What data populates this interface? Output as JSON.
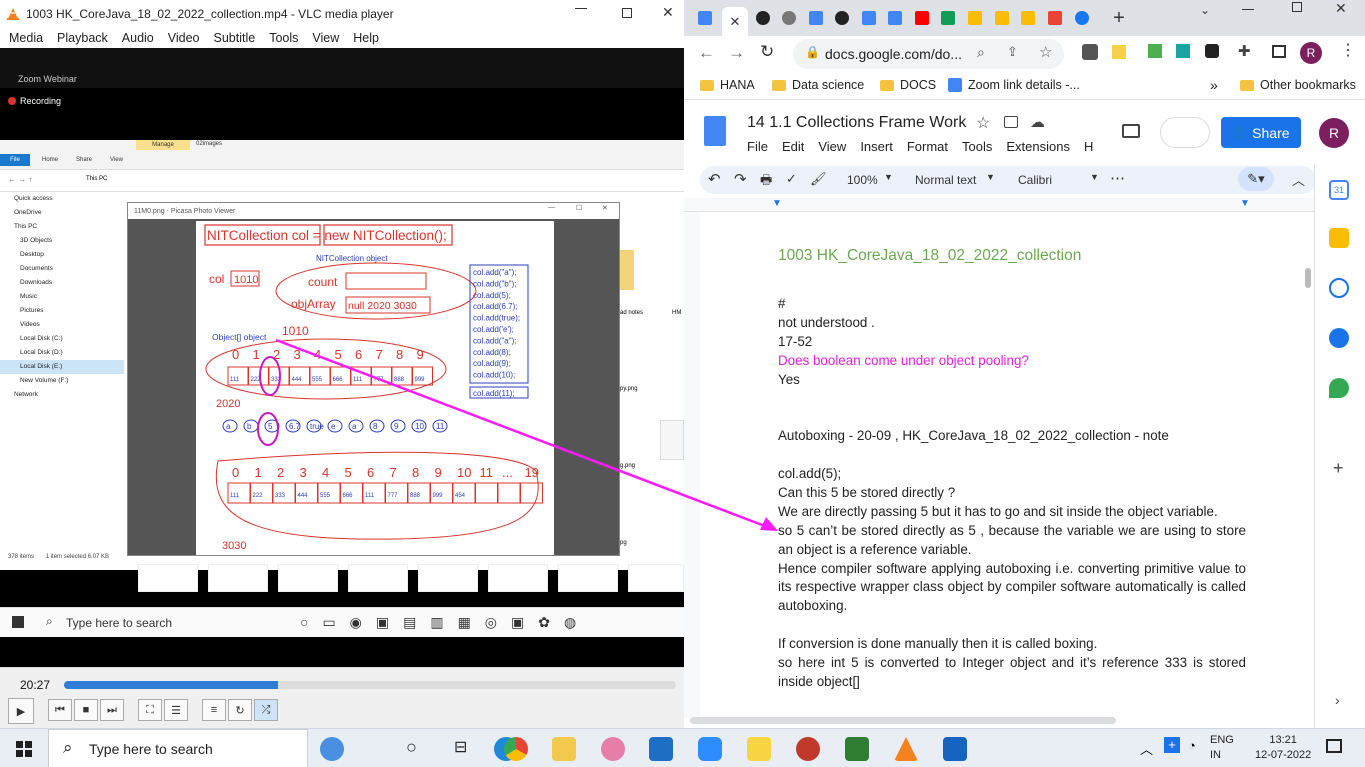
{
  "vlc": {
    "title": "1003 HK_CoreJava_18_02_2022_collection.mp4 - VLC media player",
    "menu": [
      "Media",
      "Playback",
      "Audio",
      "Video",
      "Subtitle",
      "Tools",
      "View",
      "Help"
    ],
    "time": "20:27",
    "progress": 0.35
  },
  "video": {
    "zoom_title": "Zoom Webinar",
    "recording": "Recording",
    "explorer": {
      "ribbon_tab_manage": "Manage",
      "ribbon_tab_images": "02images",
      "ribbon_tabs": [
        "File",
        "Home",
        "Share",
        "View"
      ],
      "address": "This PC",
      "nav": [
        "Quick access",
        "OneDrive",
        "This PC",
        "3D Objects",
        "Desktop",
        "Documents",
        "Downloads",
        "Music",
        "Pictures",
        "Videos",
        "Local Disk (C:)",
        "Local Disk (D:)",
        "Local Disk (E:)",
        "New Volume (F:)",
        "Network"
      ],
      "status_items": "378 items",
      "status_selected": "1 item selected  6.07 KB",
      "thumb_labels": [
        "ad notes",
        "HM",
        "py.png",
        "g.png",
        "pg"
      ]
    },
    "picasa_title": "11M0.png - Picasa Photo Viewer",
    "slide": {
      "top_line": "NITCollection col = new NITCollection();",
      "object_label": "NITCollection object",
      "col_value": "1010",
      "count": "count",
      "objArray": "objArray",
      "objArray_value": "null 2020 3030",
      "addr_1010": "1010",
      "object_array_label": "Object[] object",
      "addr_2020": "2020",
      "addr_3030": "3030",
      "col_label": "col",
      "indices_top": [
        "0",
        "1",
        "2",
        "3",
        "4",
        "5",
        "6",
        "7",
        "8",
        "9"
      ],
      "refs_top": [
        "111",
        "222",
        "333",
        "444",
        "555",
        "666",
        "111",
        "777",
        "888",
        "999"
      ],
      "values": [
        "a",
        "b",
        "5",
        "6.7",
        "true",
        "e",
        "a",
        "8",
        "9",
        "10",
        "11"
      ],
      "indices_bottom": [
        "0",
        "1",
        "2",
        "3",
        "4",
        "5",
        "6",
        "7",
        "8",
        "9",
        "10",
        "11",
        "...",
        "19"
      ],
      "refs_bottom": [
        "111",
        "222",
        "333",
        "444",
        "555",
        "666",
        "111",
        "777",
        "888",
        "999",
        "454"
      ],
      "calls": [
        "col.add(\"a\");",
        "col.add(\"b\");",
        "col.add(5);",
        "col.add(6.7);",
        "col.add(true);",
        "col.add('e');",
        "col.add(\"a\");",
        "col.add(8);",
        "col.add(9);",
        "col.add(10);"
      ],
      "call_last": "col.add(11);"
    },
    "inner_search": "Type here to search"
  },
  "chrome": {
    "url": "docs.google.com/do...",
    "profile_initial": "R",
    "bookmarks": [
      "HANA",
      "Data science",
      "DOCS",
      "Zoom link details -..."
    ],
    "other_bookmarks": "Other bookmarks",
    "more": "»"
  },
  "docs": {
    "title": "14 1.1 Collections Frame Work",
    "menus": [
      "File",
      "Edit",
      "View",
      "Insert",
      "Format",
      "Tools",
      "Extensions",
      "H"
    ],
    "share_label": "Share",
    "avatar": "R",
    "zoom": "100%",
    "style": "Normal text",
    "font": "Calibri",
    "lines": {
      "heading": "1003 HK_CoreJava_18_02_2022_collection",
      "l1": "#",
      "l2": "not understood .",
      "l3": "17-52",
      "l4": "Does boolean come under object pooling?",
      "l5": "Yes",
      "l6": "Autoboxing - 20-09 , HK_CoreJava_18_02_2022_collection - note",
      "l7": "col.add(5);",
      "l8": "Can this 5 be stored directly ?",
      "l9": "We are directly passing 5 but it has to go and sit inside the object variable.",
      "l10": "so 5 can’t be stored directly as 5 , because the variable we are using to store an object is a reference variable.",
      "l11": "Hence compiler software applying autoboxing i.e. converting primitive value to its respective wrapper class object by compiler software automatically  is called autoboxing.",
      "l12": "If conversion is done manually then it is called boxing.",
      "l13": "so here int 5 is converted to Integer object and it’s reference 333 is stored inside object[]"
    }
  },
  "taskbar": {
    "search": "Type here to search",
    "lang1": "ENG",
    "lang2": "IN",
    "time": "13:21",
    "date": "12-07-2022"
  },
  "colors": {
    "accent_blue": "#1a73e8",
    "arrow_magenta": "#ff19ff",
    "heading_green": "#6aa84f",
    "pink_text": "#e31fd8",
    "slide_red": "#d9342b",
    "slide_blue": "#2b3fb8"
  }
}
